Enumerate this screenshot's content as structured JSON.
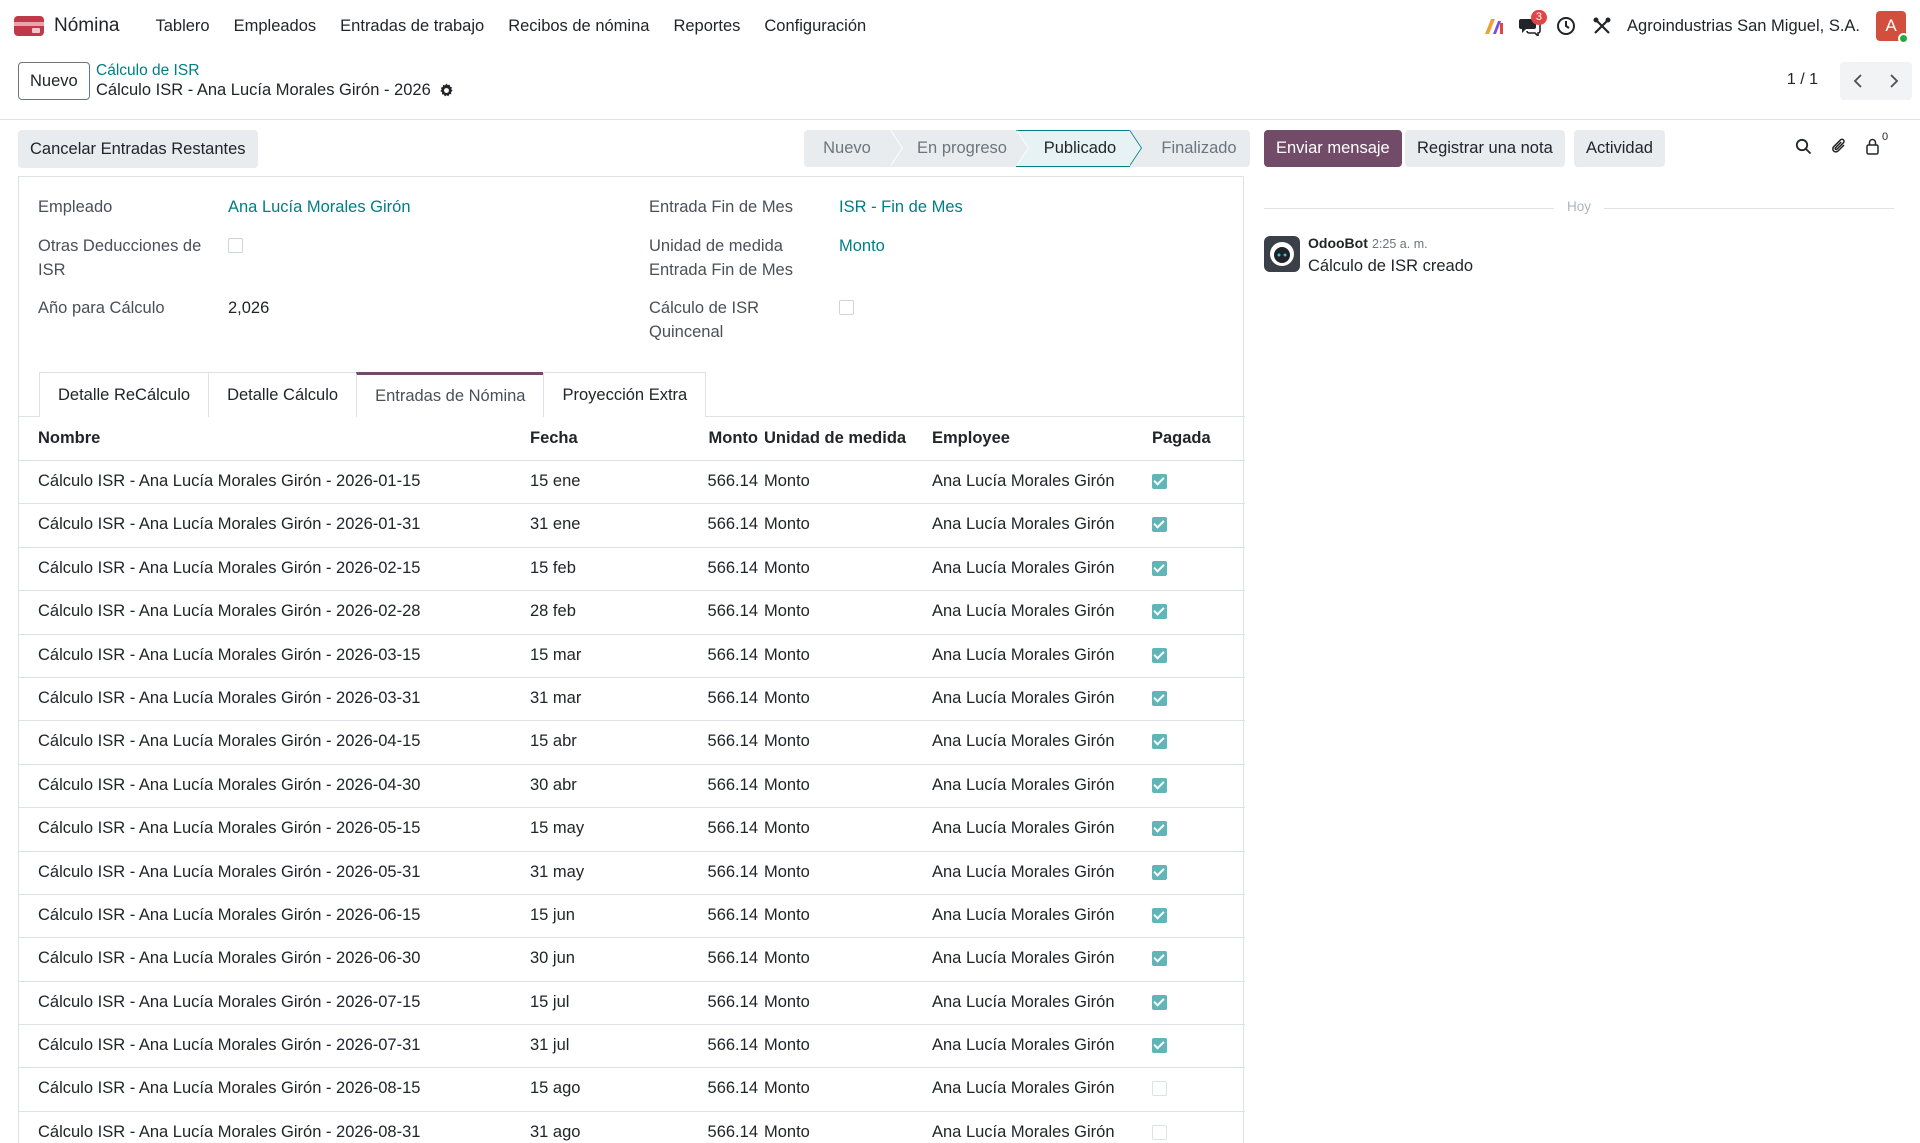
{
  "navbar": {
    "app_name": "Nómina",
    "menu": [
      "Tablero",
      "Empleados",
      "Entradas de trabajo",
      "Recibos de nómina",
      "Reportes",
      "Configuración"
    ],
    "messages_badge": "3",
    "company": "Agroindustrias San Miguel, S.A.",
    "avatar_letter": "A",
    "brand_color": "#714b67"
  },
  "control": {
    "new_button": "Nuevo",
    "breadcrumb_parent": "Cálculo de ISR",
    "breadcrumb_current": "Cálculo ISR - Ana Lucía Morales Girón - 2026",
    "pager": "1 / 1"
  },
  "actions": {
    "cancel_button": "Cancelar Entradas Restantes",
    "stages": [
      "Nuevo",
      "En progreso",
      "Publicado",
      "Finalizado"
    ],
    "active_stage": "Publicado"
  },
  "form": {
    "employee_label": "Empleado",
    "employee_value": "Ana Lucía Morales Girón",
    "other_deductions_label": "Otras Deducciones de ISR",
    "other_deductions_checked": false,
    "year_label": "Año para Cálculo",
    "year_value": "2,026",
    "month_end_entry_label": "Entrada Fin de Mes",
    "month_end_entry_value": "ISR - Fin de Mes",
    "uom_label": "Unidad de medida Entrada Fin de Mes",
    "uom_value": "Monto",
    "biweekly_label": "Cálculo de ISR Quincenal",
    "biweekly_checked": false
  },
  "tabs": [
    "Detalle ReCálculo",
    "Detalle Cálculo",
    "Entradas de Nómina",
    "Proyección Extra"
  ],
  "active_tab": "Entradas de Nómina",
  "table": {
    "headers": [
      "Nombre",
      "Fecha",
      "Monto",
      "Unidad de medida",
      "Employee",
      "Pagada"
    ],
    "rows": [
      {
        "name": "Cálculo ISR - Ana Lucía Morales Girón - 2026-01-15",
        "date": "15 ene",
        "amount": "566.14",
        "unit": "Monto",
        "employee": "Ana Lucía Morales Girón",
        "paid": true
      },
      {
        "name": "Cálculo ISR - Ana Lucía Morales Girón - 2026-01-31",
        "date": "31 ene",
        "amount": "566.14",
        "unit": "Monto",
        "employee": "Ana Lucía Morales Girón",
        "paid": true
      },
      {
        "name": "Cálculo ISR - Ana Lucía Morales Girón - 2026-02-15",
        "date": "15 feb",
        "amount": "566.14",
        "unit": "Monto",
        "employee": "Ana Lucía Morales Girón",
        "paid": true
      },
      {
        "name": "Cálculo ISR - Ana Lucía Morales Girón - 2026-02-28",
        "date": "28 feb",
        "amount": "566.14",
        "unit": "Monto",
        "employee": "Ana Lucía Morales Girón",
        "paid": true
      },
      {
        "name": "Cálculo ISR - Ana Lucía Morales Girón - 2026-03-15",
        "date": "15 mar",
        "amount": "566.14",
        "unit": "Monto",
        "employee": "Ana Lucía Morales Girón",
        "paid": true
      },
      {
        "name": "Cálculo ISR - Ana Lucía Morales Girón - 2026-03-31",
        "date": "31 mar",
        "amount": "566.14",
        "unit": "Monto",
        "employee": "Ana Lucía Morales Girón",
        "paid": true
      },
      {
        "name": "Cálculo ISR - Ana Lucía Morales Girón - 2026-04-15",
        "date": "15 abr",
        "amount": "566.14",
        "unit": "Monto",
        "employee": "Ana Lucía Morales Girón",
        "paid": true
      },
      {
        "name": "Cálculo ISR - Ana Lucía Morales Girón - 2026-04-30",
        "date": "30 abr",
        "amount": "566.14",
        "unit": "Monto",
        "employee": "Ana Lucía Morales Girón",
        "paid": true
      },
      {
        "name": "Cálculo ISR - Ana Lucía Morales Girón - 2026-05-15",
        "date": "15 may",
        "amount": "566.14",
        "unit": "Monto",
        "employee": "Ana Lucía Morales Girón",
        "paid": true
      },
      {
        "name": "Cálculo ISR - Ana Lucía Morales Girón - 2026-05-31",
        "date": "31 may",
        "amount": "566.14",
        "unit": "Monto",
        "employee": "Ana Lucía Morales Girón",
        "paid": true
      },
      {
        "name": "Cálculo ISR - Ana Lucía Morales Girón - 2026-06-15",
        "date": "15 jun",
        "amount": "566.14",
        "unit": "Monto",
        "employee": "Ana Lucía Morales Girón",
        "paid": true
      },
      {
        "name": "Cálculo ISR - Ana Lucía Morales Girón - 2026-06-30",
        "date": "30 jun",
        "amount": "566.14",
        "unit": "Monto",
        "employee": "Ana Lucía Morales Girón",
        "paid": true
      },
      {
        "name": "Cálculo ISR - Ana Lucía Morales Girón - 2026-07-15",
        "date": "15 jul",
        "amount": "566.14",
        "unit": "Monto",
        "employee": "Ana Lucía Morales Girón",
        "paid": true
      },
      {
        "name": "Cálculo ISR - Ana Lucía Morales Girón - 2026-07-31",
        "date": "31 jul",
        "amount": "566.14",
        "unit": "Monto",
        "employee": "Ana Lucía Morales Girón",
        "paid": true
      },
      {
        "name": "Cálculo ISR - Ana Lucía Morales Girón - 2026-08-15",
        "date": "15 ago",
        "amount": "566.14",
        "unit": "Monto",
        "employee": "Ana Lucía Morales Girón",
        "paid": false
      },
      {
        "name": "Cálculo ISR - Ana Lucía Morales Girón - 2026-08-31",
        "date": "31 ago",
        "amount": "566.14",
        "unit": "Monto",
        "employee": "Ana Lucía Morales Girón",
        "paid": false
      }
    ]
  },
  "chatter": {
    "send_message": "Enviar mensaje",
    "log_note": "Registrar una nota",
    "activity": "Actividad",
    "followers_count": "0",
    "day_separator": "Hoy",
    "message_author": "OdooBot",
    "message_time": "2:25 a. m.",
    "message_body": "Cálculo de ISR creado"
  }
}
